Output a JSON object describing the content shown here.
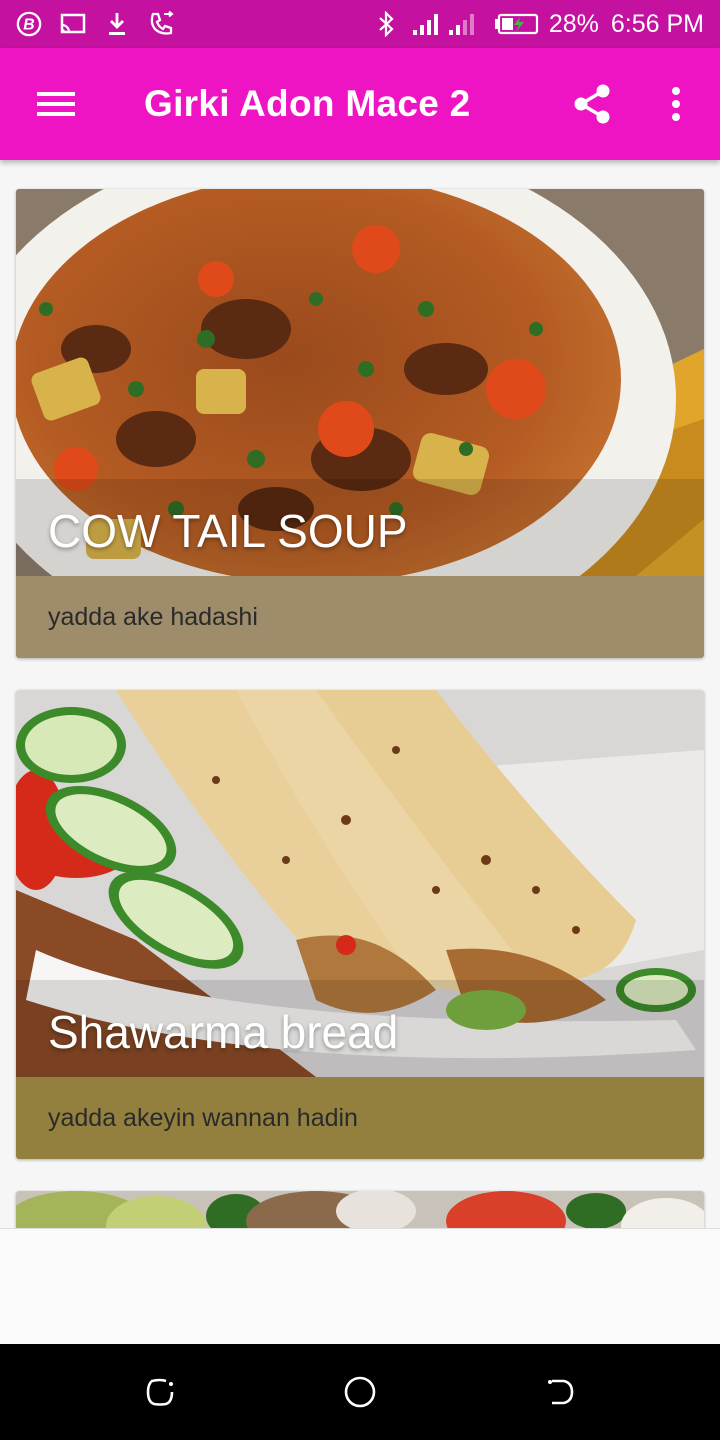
{
  "status_bar": {
    "battery_percent": "28%",
    "time": "6:56 PM",
    "icons": [
      "b-icon",
      "cast-icon",
      "download-icon",
      "call-icon",
      "bluetooth-icon",
      "signal-icon",
      "battery-icon"
    ]
  },
  "app_bar": {
    "title": "Girki Adon Mace 2",
    "icons": [
      "menu-icon",
      "share-icon",
      "more-vert-icon"
    ],
    "background": "#ee14c4"
  },
  "cards": [
    {
      "title": "COW TAIL SOUP",
      "subtitle": "yadda ake hadashi",
      "footer_color": "#9e8c6b"
    },
    {
      "title": "Shawarma bread",
      "subtitle": "yadda akeyin wannan hadin",
      "footer_color": "#93803e"
    }
  ],
  "nav_bar": {
    "icons": [
      "recent-apps-icon",
      "home-icon",
      "back-icon"
    ]
  }
}
